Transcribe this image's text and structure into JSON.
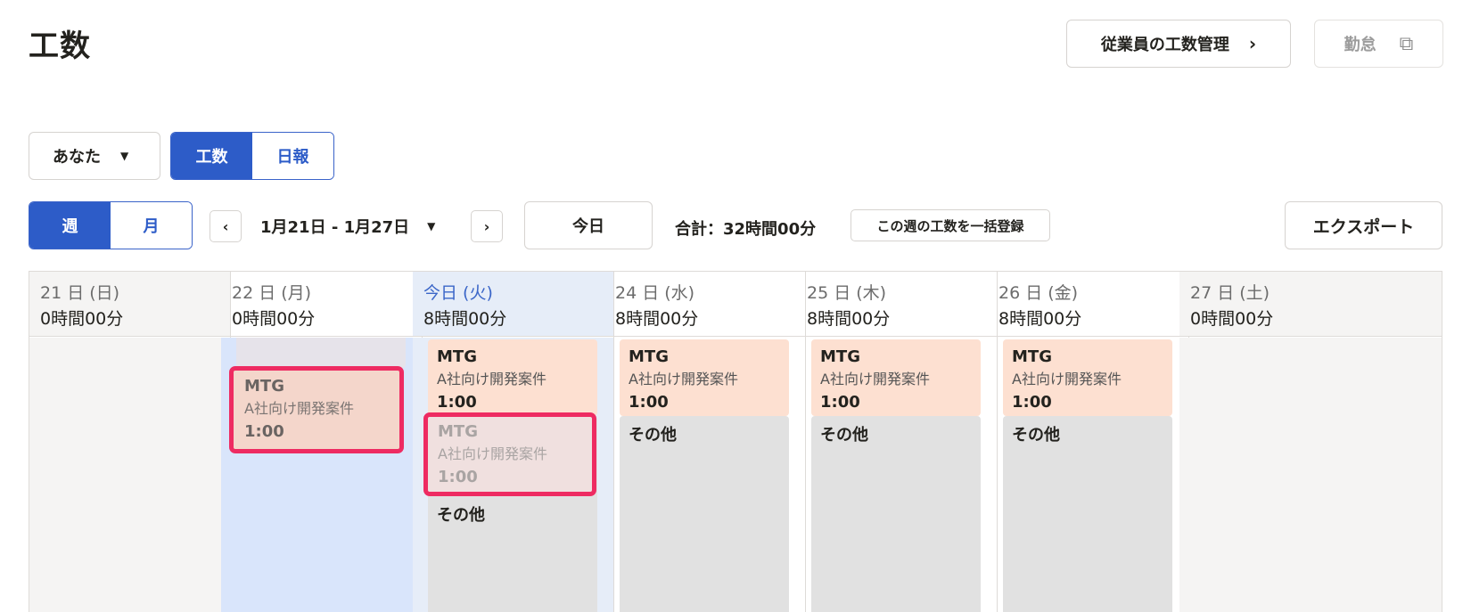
{
  "header": {
    "title": "工数",
    "manage_button": "従業員の工数管理",
    "manage_icon": "›",
    "kintai_button": "勤怠",
    "kintai_icon": "⧉"
  },
  "filters": {
    "user_select": "あなた",
    "mode_tabs": [
      {
        "label": "工数",
        "active": true
      },
      {
        "label": "日報",
        "active": false
      }
    ]
  },
  "toolbar": {
    "view_tabs": [
      {
        "label": "週",
        "active": true
      },
      {
        "label": "月",
        "active": false
      }
    ],
    "prev_icon": "‹",
    "next_icon": "›",
    "date_range": "1月21日 - 1月27日",
    "today_button": "今日",
    "total": "合計：32時間00分",
    "bulk_button": "この週の工数を一括登録",
    "export_button": "エクスポート"
  },
  "calendar": {
    "days": [
      {
        "label": "21 日 (日)",
        "hours": "0時間00分"
      },
      {
        "label": "22 日 (月)",
        "hours": "0時間00分"
      },
      {
        "label": "今日 (火)",
        "hours": "8時間00分"
      },
      {
        "label": "24 日 (水)",
        "hours": "8時間00分"
      },
      {
        "label": "25 日 (木)",
        "hours": "8時間00分"
      },
      {
        "label": "26 日 (金)",
        "hours": "8時間00分"
      },
      {
        "label": "27 日 (土)",
        "hours": "0時間00分"
      }
    ],
    "mtg_entry": {
      "title": "MTG",
      "project": "A社向け開発案件",
      "duration": "1:00"
    },
    "other_entry": {
      "title": "その他"
    },
    "colors": {
      "primary": "#2d5cc8",
      "mtg_card": "#fde0d1",
      "other_card": "#e1e1e1",
      "highlight_border": "#ee2b62",
      "dragged_column": "#d9e5fb"
    }
  }
}
